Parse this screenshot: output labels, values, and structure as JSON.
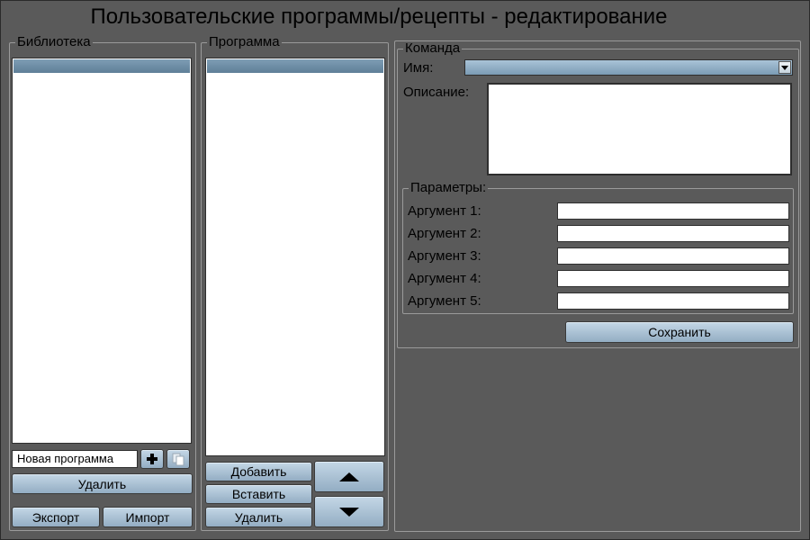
{
  "window": {
    "title": "Пользовательские программы/рецепты - редактирование"
  },
  "library": {
    "legend": "Библиотека",
    "new_name_value": "Новая программа",
    "delete_label": "Удалить",
    "export_label": "Экспорт",
    "import_label": "Импорт",
    "add_icon": "plus-icon",
    "copy_icon": "copy-icon"
  },
  "program": {
    "legend": "Программа",
    "add_label": "Добавить",
    "insert_label": "Вставить",
    "delete_label": "Удалить",
    "up_icon": "arrow-up-icon",
    "down_icon": "arrow-down-icon"
  },
  "command": {
    "legend": "Команда",
    "name_label": "Имя:",
    "name_value": "",
    "description_label": "Описание:",
    "description_value": "",
    "params": {
      "legend": "Параметры:",
      "args": [
        {
          "label": "Аргумент 1:",
          "value": ""
        },
        {
          "label": "Аргумент 2:",
          "value": ""
        },
        {
          "label": "Аргумент 3:",
          "value": ""
        },
        {
          "label": "Аргумент 4:",
          "value": ""
        },
        {
          "label": "Аргумент 5:",
          "value": ""
        }
      ]
    },
    "save_label": "Сохранить"
  },
  "colors": {
    "background": "#5a5a5a",
    "button_top": "#c4d7e6",
    "button_bottom": "#93adc3",
    "selection": "#6f8fa8"
  }
}
